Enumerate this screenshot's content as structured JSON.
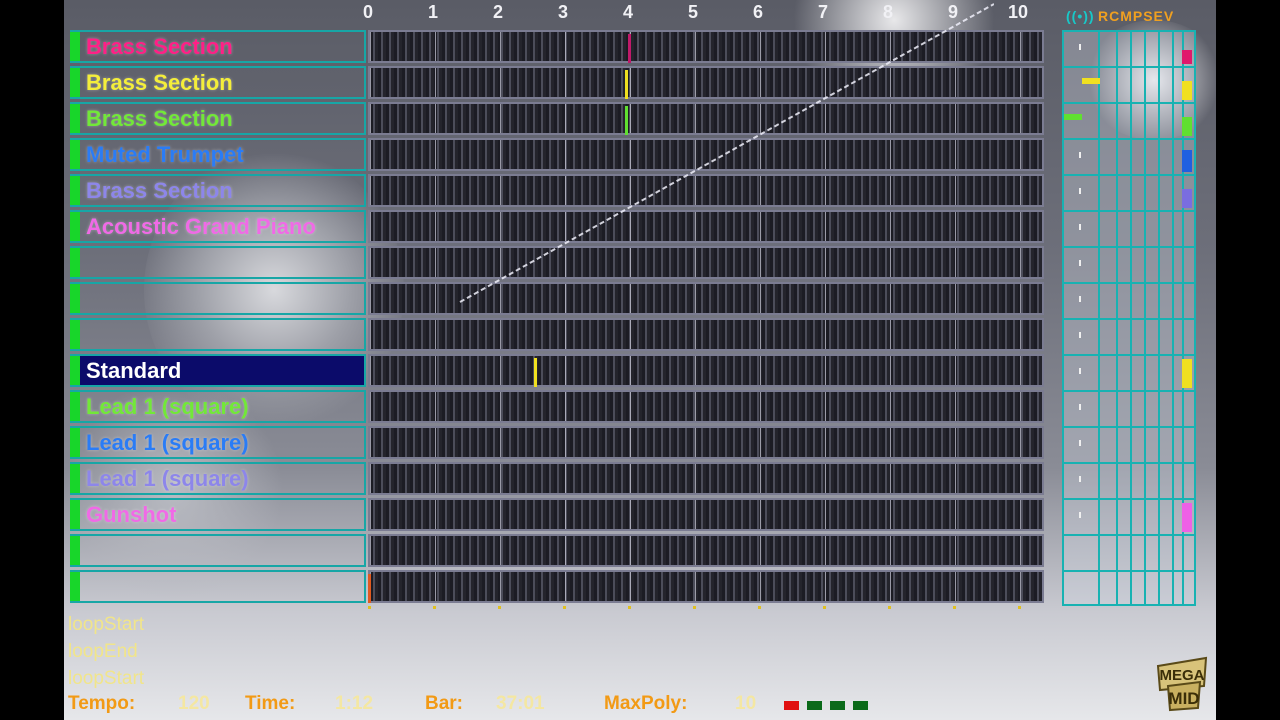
{
  "timeline": {
    "bar_numbers": [
      "0",
      "1",
      "2",
      "3",
      "4",
      "5",
      "6",
      "7",
      "8",
      "9",
      "10"
    ]
  },
  "panel_header": "RCMPSEV",
  "panel_icon": "speaker-waves-icon",
  "tracks": [
    {
      "name": "Brass Section",
      "color": "#ff1f86",
      "selected": false,
      "marker_pos": 4.0,
      "marker_color": "#c01a6a",
      "level": 0.45,
      "level_color": "#e0186c",
      "pan": null
    },
    {
      "name": "Brass Section",
      "color": "#f4ee3a",
      "selected": false,
      "marker_pos": 3.95,
      "marker_color": "#f0e020",
      "level": 0.6,
      "level_color": "#f0e020",
      "pan": 0.5
    },
    {
      "name": "Brass Section",
      "color": "#72e838",
      "selected": false,
      "marker_pos": 3.95,
      "marker_color": "#60e030",
      "level": 0.6,
      "level_color": "#60e030",
      "pan": 0.0
    },
    {
      "name": "Muted Trumpet",
      "color": "#2a7cf6",
      "selected": false,
      "marker_pos": null,
      "marker_color": "",
      "level": 0.7,
      "level_color": "#2060e0",
      "pan": null
    },
    {
      "name": "Brass Section",
      "color": "#8d86ea",
      "selected": false,
      "marker_pos": null,
      "marker_color": "",
      "level": 0.6,
      "level_color": "#7a6de0",
      "pan": null
    },
    {
      "name": "Acoustic Grand Piano",
      "color": "#f06ae6",
      "selected": false,
      "marker_pos": null,
      "marker_color": "",
      "level": 0,
      "level_color": "",
      "pan": null
    },
    {
      "name": "",
      "color": "",
      "selected": false,
      "marker_pos": null,
      "marker_color": "",
      "level": 0,
      "level_color": "",
      "pan": null
    },
    {
      "name": "",
      "color": "",
      "selected": false,
      "marker_pos": null,
      "marker_color": "",
      "level": 0,
      "level_color": "",
      "pan": null
    },
    {
      "name": "",
      "color": "",
      "selected": false,
      "marker_pos": null,
      "marker_color": "",
      "level": 0,
      "level_color": "",
      "pan": null
    },
    {
      "name": "Standard",
      "color": "#ffffff",
      "selected": true,
      "marker_pos": 2.55,
      "marker_color": "#f0e020",
      "level": 0.9,
      "level_color": "#f0e020",
      "pan": null
    },
    {
      "name": "Lead 1 (square)",
      "color": "#72e838",
      "selected": false,
      "marker_pos": null,
      "marker_color": "",
      "level": 0,
      "level_color": "",
      "pan": null
    },
    {
      "name": "Lead 1 (square)",
      "color": "#2a7cf6",
      "selected": false,
      "marker_pos": null,
      "marker_color": "",
      "level": 0,
      "level_color": "",
      "pan": null
    },
    {
      "name": "Lead 1 (square)",
      "color": "#8d86ea",
      "selected": false,
      "marker_pos": null,
      "marker_color": "",
      "level": 0,
      "level_color": "",
      "pan": null
    },
    {
      "name": "Gunshot",
      "color": "#f06ae6",
      "selected": false,
      "marker_pos": null,
      "marker_color": "",
      "level": 0.9,
      "level_color": "#ee60e6",
      "pan": null
    },
    {
      "name": "",
      "color": "",
      "selected": false,
      "marker_pos": null,
      "marker_color": "",
      "level": 0,
      "level_color": "",
      "pan": null
    },
    {
      "name": "",
      "color": "",
      "selected": false,
      "marker_pos": 0.0,
      "marker_color": "#e05a20",
      "level": 0,
      "level_color": "",
      "pan": null
    }
  ],
  "log_lines": [
    "loopStart",
    "loopEnd",
    "loopStart"
  ],
  "status": {
    "tempo_label": "Tempo:",
    "tempo": "120",
    "time_label": "Time:",
    "time": "1:12",
    "bar_label": "Bar:",
    "bar": "37:01",
    "maxpoly_label": "MaxPoly:",
    "maxpoly": "10"
  },
  "poly_leds": [
    {
      "color": "#e01010",
      "lit": true
    },
    {
      "color": "#0b6a1a",
      "lit": false
    },
    {
      "color": "#0b6a1a",
      "lit": false
    },
    {
      "color": "#0b6a1a",
      "lit": false
    }
  ],
  "logo_text": "MEGA MID"
}
